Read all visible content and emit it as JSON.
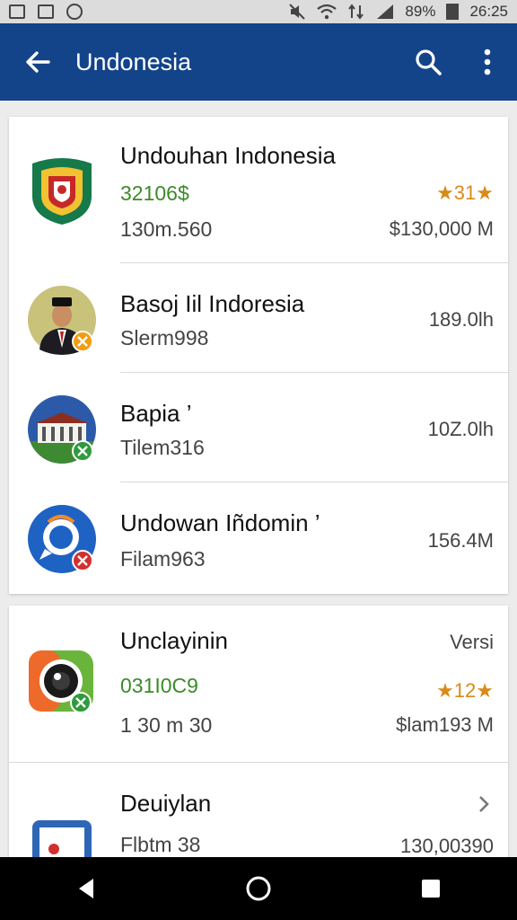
{
  "status": {
    "battery": "89%",
    "time": "26:25"
  },
  "appbar": {
    "title": "Undonesia"
  },
  "apps": [
    {
      "title": "Undouhan Indonesia",
      "subtitle": "32106$",
      "detail": "130m.560",
      "rating": "★31★",
      "value": "$130,000 M"
    },
    {
      "title": "Basoj Iil Indoresia",
      "subtitle": "Slerm998",
      "value": "189.0lh"
    },
    {
      "title": "Bapia ’",
      "subtitle": "Tilem316",
      "value": "10Z.0lh"
    },
    {
      "title": "Undowan Iñdomin ’",
      "subtitle": "Filam963",
      "value": "156.4M"
    },
    {
      "title": "Unclayinin",
      "subtitle": "031I0C9",
      "detail": "1 30 m 30",
      "top_right": "Versi",
      "rating": "★12★",
      "value": "$lam193 M"
    },
    {
      "title": "Deuiylan",
      "subtitle": "Flbtm 38",
      "value": "130,00390"
    }
  ],
  "colors": {
    "appbar": "#13448a",
    "green_text": "#3c8a2a",
    "rating": "#d98a18"
  }
}
